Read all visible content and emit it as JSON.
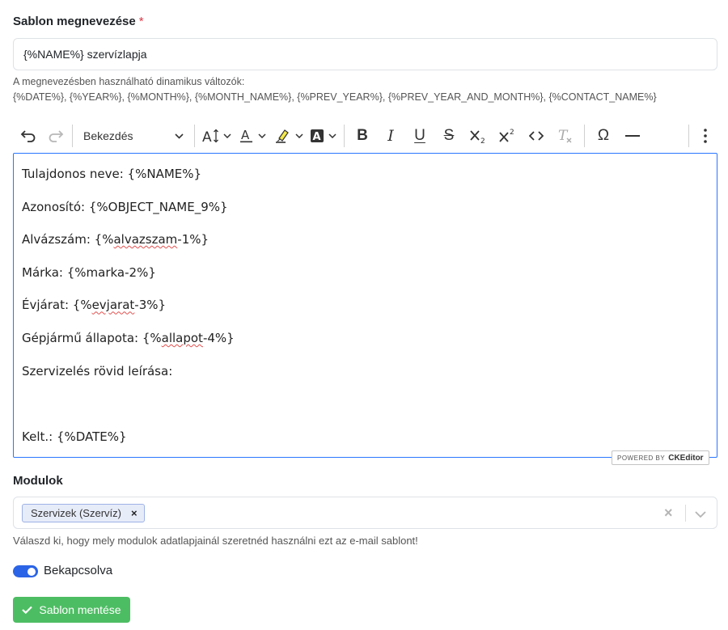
{
  "template_name": {
    "label": "Sablon megnevezése",
    "required_mark": "*",
    "value": "{%NAME%} szervízlapja",
    "help_line1": "A megnevezésben használható dinamikus változók:",
    "help_line2": "{%DATE%}, {%YEAR%}, {%MONTH%}, {%MONTH_NAME%}, {%PREV_YEAR%}, {%PREV_YEAR_AND_MONTH%}, {%CONTACT_NAME%}"
  },
  "toolbar": {
    "heading_select": "Bekezdés",
    "icons": [
      "undo-icon",
      "redo-icon",
      "font-size-icon",
      "font-color-icon",
      "highlight-icon",
      "background-color-icon",
      "bold-icon",
      "italic-icon",
      "underline-icon",
      "strikethrough-icon",
      "subscript-icon",
      "superscript-icon",
      "code-icon",
      "remove-format-icon",
      "special-characters-icon",
      "horizontal-line-icon",
      "more-icon"
    ]
  },
  "editor": {
    "lines": [
      {
        "before": "Tulajdonos neve: {%NAME%}",
        "spell": "",
        "after": ""
      },
      {
        "before": "Azonosító: {%OBJECT_NAME_9%}",
        "spell": "",
        "after": ""
      },
      {
        "before": "Alvázszám: {%",
        "spell": "alvazszam",
        "after": "-1%}"
      },
      {
        "before": "Márka: {%marka-2%}",
        "spell": "",
        "after": ""
      },
      {
        "before": "Évjárat: {%",
        "spell": "evjarat",
        "after": "-3%}"
      },
      {
        "before": "Gépjármű állapota: {%",
        "spell": "allapot",
        "after": "-4%}"
      },
      {
        "before": "Szervizelés rövid leírása:",
        "spell": "",
        "after": ""
      },
      {
        "before": "",
        "spell": "",
        "after": ""
      },
      {
        "before": "Kelt.: {%DATE%}",
        "spell": "",
        "after": ""
      }
    ],
    "powered_by": "POWERED BY",
    "powered_logo": "CKEditor"
  },
  "modules": {
    "label": "Modulok",
    "selected_chip": "Szervizek (Szervíz)",
    "chip_remove": "×",
    "clear": "×",
    "help": "Válaszd ki, hogy mely modulok adatlapjainál szeretnéd használni ezt az e-mail sablont!"
  },
  "enabled_toggle": {
    "label": "Bekapcsolva",
    "checked": true
  },
  "save_button": {
    "label": "Sablon mentése"
  },
  "colors": {
    "accent": "#2977ff",
    "toggle": "#2b64e6",
    "save": "#4dbd63",
    "required": "#dc3545"
  }
}
